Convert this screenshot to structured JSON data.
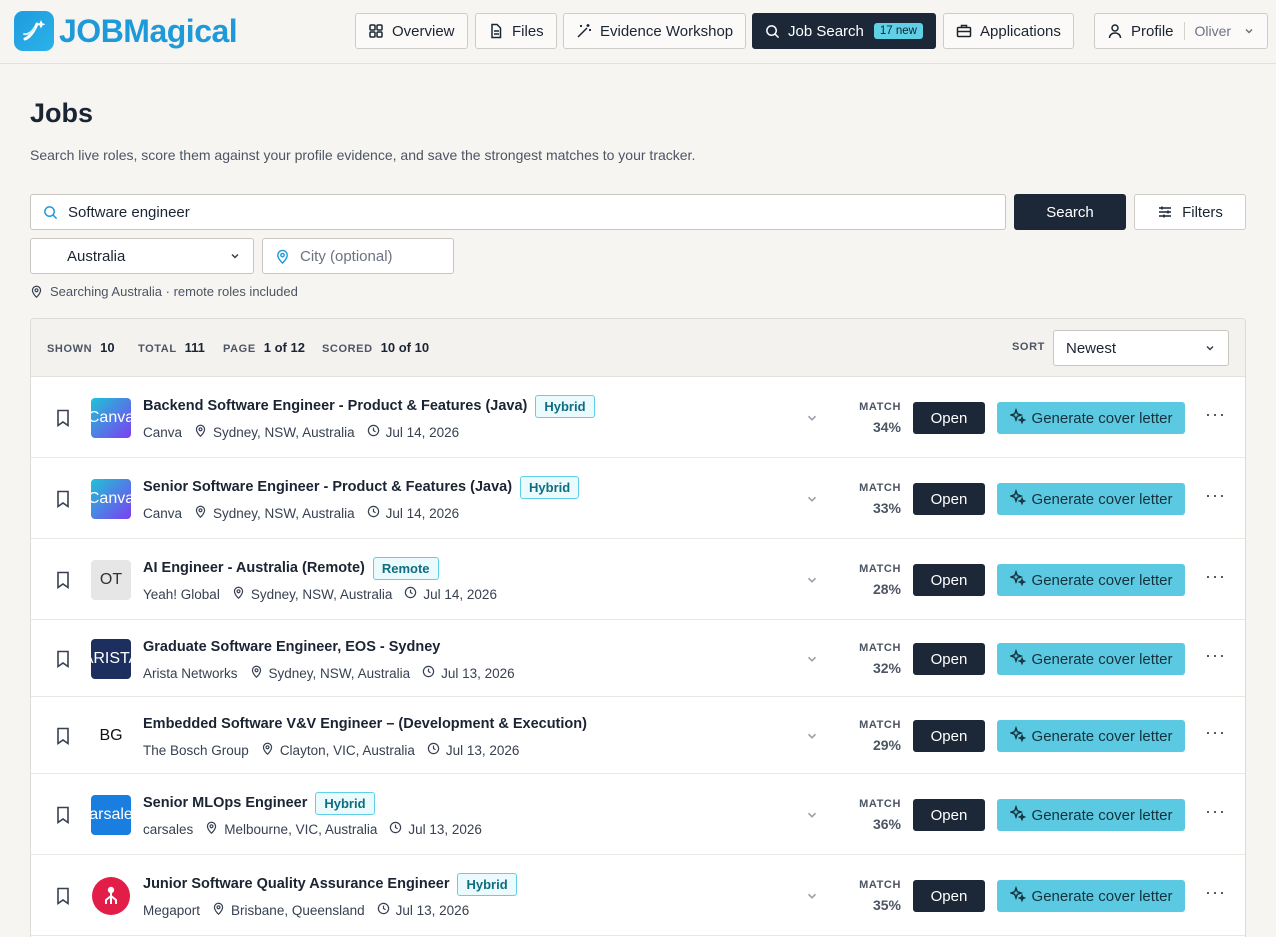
{
  "app": {
    "name": "JOBMagical"
  },
  "nav": {
    "overview": "Overview",
    "files": "Files",
    "evidence": "Evidence Workshop",
    "job_search": "Job Search",
    "job_search_badge": "17 new",
    "applications": "Applications",
    "profile": "Profile",
    "profile_user": "Oliver"
  },
  "page": {
    "title": "Jobs",
    "subtitle": "Search live roles, score them against your profile evidence, and save the strongest matches to your tracker."
  },
  "search": {
    "query": "Software engineer",
    "search_button": "Search",
    "filters_button": "Filters",
    "country": "Australia",
    "city_placeholder": "City (optional)",
    "scope_note": "Searching Australia · remote roles included"
  },
  "stats": {
    "shown_label": "SHOWN",
    "shown": "10",
    "total_label": "TOTAL",
    "total": "111",
    "page_label": "PAGE",
    "page": "1 of 12",
    "scored_label": "SCORED",
    "scored": "10 of 10",
    "sort_label": "SORT",
    "sort_value": "Newest"
  },
  "row_labels": {
    "match": "MATCH",
    "open": "Open",
    "cover": "Generate cover letter"
  },
  "jobs": [
    {
      "title": "Backend Software Engineer - Product & Features (Java)",
      "tag": "Hybrid",
      "company": "Canva",
      "location": "Sydney, NSW, Australia",
      "date": "Jul 14, 2026",
      "match": "34%",
      "logo": "Canva"
    },
    {
      "title": "Senior Software Engineer - Product & Features (Java)",
      "tag": "Hybrid",
      "company": "Canva",
      "location": "Sydney, NSW, Australia",
      "date": "Jul 14, 2026",
      "match": "33%",
      "logo": "Canva"
    },
    {
      "title": "AI Engineer - Australia (Remote)",
      "tag": "Remote",
      "company": "Yeah! Global",
      "location": "Sydney, NSW, Australia",
      "date": "Jul 14, 2026",
      "match": "28%",
      "logo": "OT"
    },
    {
      "title": "Graduate Software Engineer, EOS - Sydney",
      "tag": "",
      "company": "Arista Networks",
      "location": "Sydney, NSW, Australia",
      "date": "Jul 13, 2026",
      "match": "32%",
      "logo": "ARISTA"
    },
    {
      "title": "Embedded Software V&V Engineer – (Development & Execution)",
      "tag": "",
      "company": "The Bosch Group",
      "location": "Clayton, VIC, Australia",
      "date": "Jul 13, 2026",
      "match": "29%",
      "logo": "BG"
    },
    {
      "title": "Senior MLOps Engineer",
      "tag": "Hybrid",
      "company": "carsales",
      "location": "Melbourne, VIC, Australia",
      "date": "Jul 13, 2026",
      "match": "36%",
      "logo": "carsales"
    },
    {
      "title": "Junior Software Quality Assurance Engineer",
      "tag": "Hybrid",
      "company": "Megaport",
      "location": "Brisbane, Queensland",
      "date": "Jul 13, 2026",
      "match": "35%",
      "logo": ""
    }
  ]
}
